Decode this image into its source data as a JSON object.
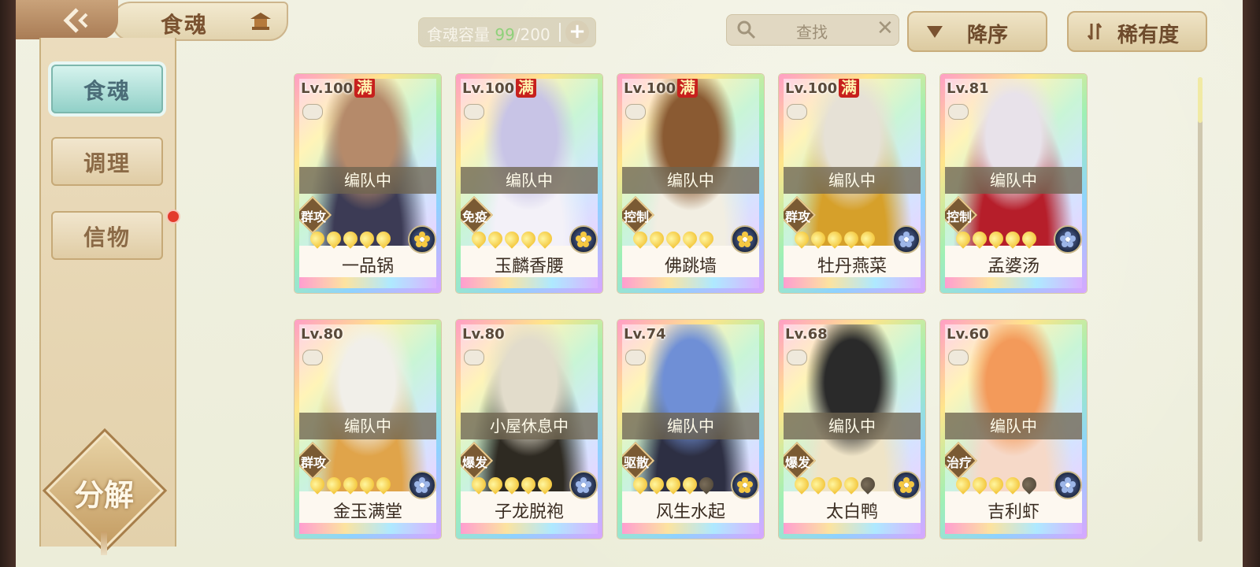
{
  "header": {
    "title": "食魂",
    "capacity_label": "食魂容量 ",
    "capacity_current": "99",
    "capacity_max": "/200",
    "capacity_add": "+"
  },
  "search": {
    "placeholder": "查找",
    "clear": "✕"
  },
  "sort": {
    "order_label": "降序",
    "rarity_label": "稀有度"
  },
  "sidebar": {
    "items": [
      {
        "label": "食魂",
        "active": true
      },
      {
        "label": "调理",
        "active": false
      },
      {
        "label": "信物",
        "active": false,
        "badge": true
      }
    ],
    "decompose_label": "分解"
  },
  "cards": [
    {
      "level": "Lv.100",
      "maxed": "满",
      "status": "编队中",
      "role": "群攻",
      "stars": 5,
      "element": "gold-flower",
      "name": "一品锅",
      "palette": [
        "#b58a6a",
        "#3c3b55"
      ]
    },
    {
      "level": "Lv.100",
      "maxed": "满",
      "status": "编队中",
      "role": "免疫",
      "stars": 5,
      "element": "gold-flower",
      "name": "玉麟香腰",
      "palette": [
        "#c8c4e6",
        "#f3f1f8"
      ]
    },
    {
      "level": "Lv.100",
      "maxed": "满",
      "status": "编队中",
      "role": "控制",
      "stars": 5,
      "element": "gold-flower",
      "name": "佛跳墙",
      "palette": [
        "#8a5a32",
        "#f2eee2"
      ]
    },
    {
      "level": "Lv.100",
      "maxed": "满",
      "status": "编队中",
      "role": "群攻",
      "stars": 5,
      "element": "blue-flower",
      "name": "牡丹燕菜",
      "palette": [
        "#e6e1d6",
        "#d6a02a"
      ]
    },
    {
      "level": "Lv.81",
      "maxed": "",
      "status": "编队中",
      "role": "控制",
      "stars": 5,
      "element": "blue-flower",
      "name": "孟婆汤",
      "palette": [
        "#e8e2ea",
        "#b61e2a"
      ]
    },
    {
      "level": "Lv.80",
      "maxed": "",
      "status": "编队中",
      "role": "群攻",
      "stars": 5,
      "element": "blue-flower",
      "name": "金玉满堂",
      "palette": [
        "#f1efe9",
        "#e0a44a"
      ]
    },
    {
      "level": "Lv.80",
      "maxed": "",
      "status": "小屋休息中",
      "role": "爆发",
      "stars": 5,
      "element": "blue-flower",
      "name": "子龙脱袍",
      "palette": [
        "#e2dccb",
        "#2e2a22"
      ]
    },
    {
      "level": "Lv.74",
      "maxed": "",
      "status": "编队中",
      "role": "驱散",
      "stars": 4,
      "element": "gold-flower",
      "name": "风生水起",
      "palette": [
        "#6f8fd6",
        "#2d2f43"
      ]
    },
    {
      "level": "Lv.68",
      "maxed": "",
      "status": "编队中",
      "role": "爆发",
      "stars": 4,
      "element": "gold-flower",
      "name": "太白鸭",
      "palette": [
        "#2a2a2a",
        "#efe4c7"
      ]
    },
    {
      "level": "Lv.60",
      "maxed": "",
      "status": "编队中",
      "role": "治疗",
      "stars": 4,
      "element": "blue-flower",
      "name": "吉利虾",
      "palette": [
        "#f39a5a",
        "#f6d9c8"
      ]
    }
  ]
}
